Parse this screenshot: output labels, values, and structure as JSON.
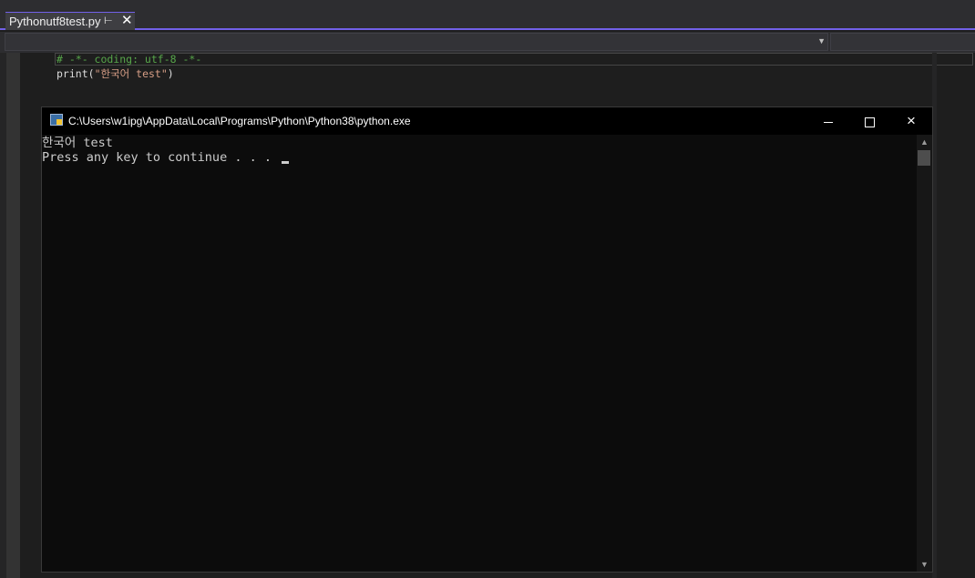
{
  "ide": {
    "tab": {
      "filename": "Pythonutf8test.py",
      "pin_icon": "pin-icon",
      "close_icon": "close-icon"
    },
    "navbar": {
      "dropdown_icon": "chevron-down-icon"
    },
    "code": {
      "line1": "# -*- coding: utf-8 -*-",
      "line2_fn": "print",
      "line2_open": "(",
      "line2_str": "\"한국어 test\"",
      "line2_close": ")"
    }
  },
  "console": {
    "title": "C:\\Users\\w1ipg\\AppData\\Local\\Programs\\Python\\Python38\\python.exe",
    "output": [
      "한국어 test",
      "Press any key to continue . . . "
    ],
    "controls": {
      "minimize": "minimize-icon",
      "maximize": "maximize-icon",
      "close": "×"
    }
  },
  "colors": {
    "accent": "#7160e8",
    "comment": "#57a64a",
    "string": "#d69d85",
    "console_bg": "#0c0c0c"
  }
}
